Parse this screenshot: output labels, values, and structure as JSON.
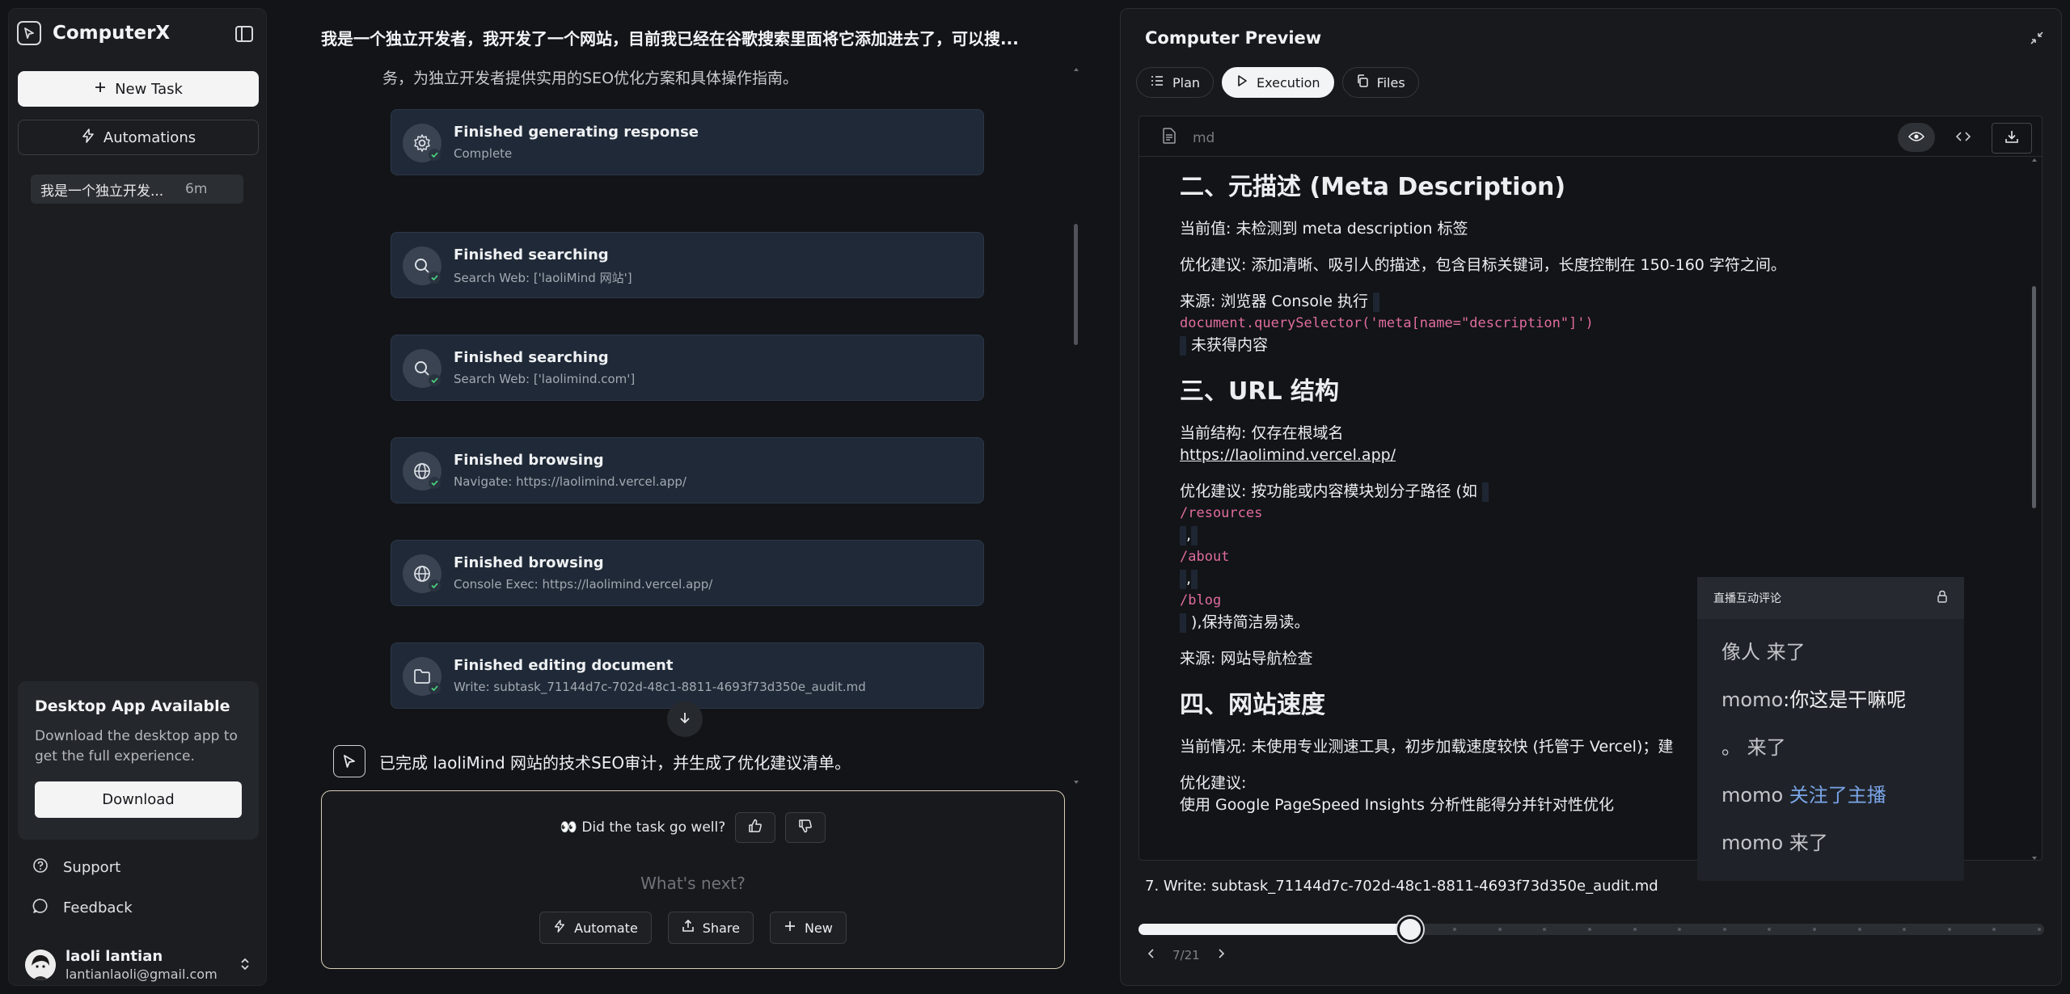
{
  "sidebar": {
    "app_name": "ComputerX",
    "new_task_label": "New Task",
    "automations_label": "Automations",
    "tasks": [
      {
        "title": "我是一个独立开发...",
        "time": "6m"
      }
    ],
    "desktop_card": {
      "title": "Desktop App Available",
      "description": "Download the desktop app to get the full experience.",
      "button_label": "Download"
    },
    "links": {
      "support": "Support",
      "feedback": "Feedback"
    },
    "user": {
      "name": "laoli lantian",
      "email": "lantianlaoli@gmail.com"
    }
  },
  "chat": {
    "title": "我是一个独立开发者，我开发了一个网站，目前我已经在谷歌搜索里面将它添加进去了，可以搜...",
    "partial_line": "务，为独立开发者提供实用的SEO优化方案和具体操作指南。",
    "steps": [
      {
        "title": "Finished generating response",
        "subtitle": "Complete",
        "icon": "gear-icon"
      },
      {
        "title": "Finished searching",
        "subtitle": "Search Web: ['laoliMind 网站']",
        "icon": "search-icon"
      },
      {
        "title": "Finished searching",
        "subtitle": "Search Web: ['laolimind.com']",
        "icon": "search-icon"
      },
      {
        "title": "Finished browsing",
        "subtitle": "Navigate: https://laolimind.vercel.app/",
        "icon": "globe-icon"
      },
      {
        "title": "Finished browsing",
        "subtitle": "Console Exec: https://laolimind.vercel.app/",
        "icon": "globe-icon"
      },
      {
        "title": "Finished editing document",
        "subtitle": "Write: subtask_71144d7c-702d-48c1-8811-4693f73d350e_audit.md",
        "icon": "folder-icon"
      }
    ],
    "summary": "已完成 laoliMind 网站的技术SEO审计，并生成了优化建议清单。",
    "composer": {
      "feedback_prompt": "👀 Did the task go well?",
      "placeholder": "What's next?",
      "automate_label": "Automate",
      "share_label": "Share",
      "new_label": "New"
    }
  },
  "preview": {
    "title": "Computer Preview",
    "tabs": {
      "plan": "Plan",
      "execution": "Execution",
      "files": "Files"
    },
    "file_type": "md",
    "doc": {
      "h_meta": "二、元描述 (Meta Description)",
      "meta_current": "当前值: 未检测到 meta description 标签",
      "meta_suggest": "优化建议: 添加清晰、吸引人的描述，包含目标关键词，长度控制在 150-160 字符之间。",
      "meta_source": "来源: 浏览器 Console 执行",
      "meta_code": "document.querySelector('meta[name=\"description\"]')",
      "meta_result": "未获得内容",
      "h_url": "三、URL 结构",
      "url_current": "当前结构: 仅存在根域名",
      "url_link": "https://laolimind.vercel.app/",
      "url_suggest": "优化建议: 按功能或内容模块划分子路径 (如",
      "path_resources": "/resources",
      "comma1": ",",
      "path_about": "/about",
      "comma2": ",",
      "path_blog": "/blog",
      "url_tail": "),保持简洁易读。",
      "url_source": "来源: 网站导航检查",
      "h_speed": "四、网站速度",
      "speed_current": "当前情况: 未使用专业测速工具，初步加载速度较快 (托管于 Vercel)；建",
      "speed_suggest": "优化建议:",
      "speed_cut": "使用 Google PageSpeed Insights 分析性能得分并针对性优化"
    },
    "step_label": "7. Write: subtask_71144d7c-702d-48c1-8811-4693f73d350e_audit.md",
    "progress": {
      "current": 7,
      "total": 21
    },
    "pager_text": "7/21"
  },
  "live_comments": {
    "title": "直播互动评论",
    "items": [
      {
        "name": "像人",
        "text": " 来了",
        "style": "plain"
      },
      {
        "name": "momo",
        "text": ":你这是干嘛呢",
        "style": "msg"
      },
      {
        "name": "。",
        "text": " 来了",
        "style": "plain"
      },
      {
        "name": "momo",
        "text": " 关注了主播",
        "style": "hl"
      },
      {
        "name": "momo",
        "text": " 来了",
        "style": "plain"
      }
    ]
  },
  "colors": {
    "background": "#121417",
    "panel": "#1b1d21",
    "step_card": "#1f2937",
    "code_pink": "#e06c9f",
    "live_highlight": "#7aa5e8"
  }
}
